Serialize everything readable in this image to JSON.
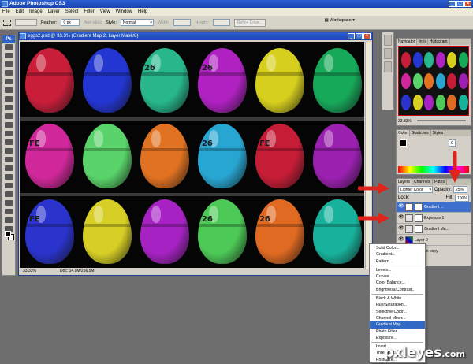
{
  "app": {
    "title": "Adobe Photoshop CS3"
  },
  "menubar": {
    "items": [
      "File",
      "Edit",
      "Image",
      "Layer",
      "Select",
      "Filter",
      "View",
      "Window",
      "Help"
    ]
  },
  "options": {
    "feather_label": "Feather:",
    "feather_value": "0 px",
    "antialias_label": "Anti-alias",
    "style_label": "Style:",
    "style_value": "Normal",
    "width_label": "Width:",
    "height_label": "Height:",
    "refine_label": "Refine Edge...",
    "workspace_label": "Workspace"
  },
  "toolbox": {
    "label": "Ps"
  },
  "document": {
    "title": "eggs2.psd @ 33.3% (Gradient Map 2, Layer Mask/8)",
    "zoom": "33.33%",
    "doc_size": "Doc: 14.9M/256.5M"
  },
  "canvas": {
    "eggs": [
      {
        "color": "#c81e3a",
        "mark": ""
      },
      {
        "color": "#2336d2",
        "mark": ""
      },
      {
        "color": "#27b78a",
        "mark": "26"
      },
      {
        "color": "#b021c2",
        "mark": "26"
      },
      {
        "color": "#d7cf1e",
        "mark": ""
      },
      {
        "color": "#17a95a",
        "mark": ""
      },
      {
        "color": "#d0289a",
        "mark": "FE"
      },
      {
        "color": "#5ad46a",
        "mark": ""
      },
      {
        "color": "#e07222",
        "mark": ""
      },
      {
        "color": "#28a6d2",
        "mark": "26"
      },
      {
        "color": "#c61d37",
        "mark": "FE"
      },
      {
        "color": "#9b21b0",
        "mark": ""
      },
      {
        "color": "#2a34cc",
        "mark": "FE"
      },
      {
        "color": "#d7cf25",
        "mark": ""
      },
      {
        "color": "#a622c3",
        "mark": ""
      },
      {
        "color": "#4cc956",
        "mark": "26"
      },
      {
        "color": "#e06a22",
        "mark": "26"
      },
      {
        "color": "#18b29c",
        "mark": ""
      }
    ]
  },
  "navigator": {
    "tabs": [
      "Navigator",
      "Info",
      "Histogram"
    ],
    "zoom": "33.33%"
  },
  "color_panel": {
    "tabs": [
      "Color",
      "Swatches",
      "Styles"
    ],
    "k_value": "0"
  },
  "layers": {
    "tabs": [
      "Layers",
      "Channels",
      "Paths"
    ],
    "blend_mode": "Lighter Color",
    "opacity_label": "Opacity:",
    "opacity_value": "25%",
    "lock_label": "Lock:",
    "fill_label": "Fill:",
    "fill_value": "100%",
    "rows": [
      {
        "name": "Gradient ...",
        "active": true
      },
      {
        "name": "Exposure 1",
        "active": false
      },
      {
        "name": "Gradient Ma...",
        "active": false
      },
      {
        "name": "Layer 0",
        "active": false
      }
    ],
    "copy_label": "an copy"
  },
  "adjust_menu": {
    "items": [
      "Solid Color...",
      "Gradient...",
      "Pattern...",
      "-",
      "Levels...",
      "Curves...",
      "Color Balance...",
      "Brightness/Contrast...",
      "-",
      "Black & White...",
      "Hue/Saturation...",
      "Selective Color...",
      "Channel Mixer...",
      "Gradient Map...",
      "Photo Filter...",
      "Exposure...",
      "-",
      "Invert",
      "Threshold...",
      "Posterize..."
    ],
    "highlighted": "Gradient Map..."
  },
  "watermark": {
    "text": "pxleyes",
    "suffix": ".com"
  }
}
